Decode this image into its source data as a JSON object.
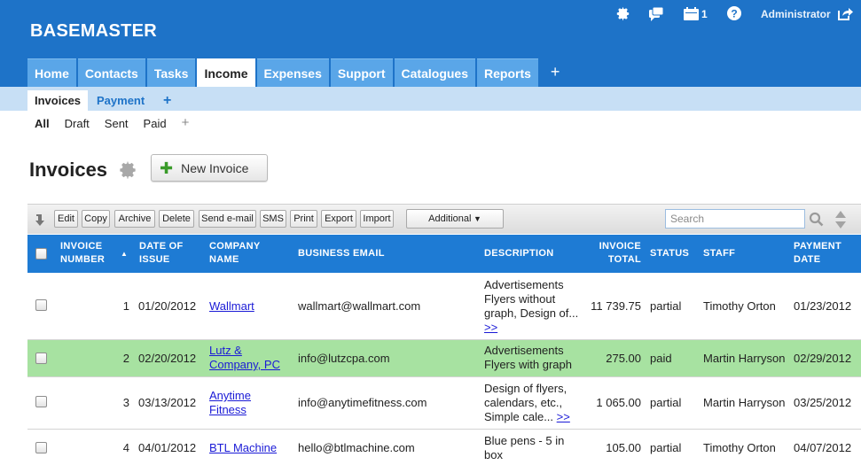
{
  "app": {
    "brand": "BASEMASTER"
  },
  "topbar": {
    "notification_count": "1",
    "user": "Administrator"
  },
  "main_tabs": [
    "Home",
    "Contacts",
    "Tasks",
    "Income",
    "Expenses",
    "Support",
    "Catalogues",
    "Reports"
  ],
  "main_tabs_plus": "+",
  "sub_tabs": [
    "Invoices",
    "Payment"
  ],
  "sub_tabs_plus": "+",
  "filters": [
    "All",
    "Draft",
    "Sent",
    "Paid"
  ],
  "filters_plus": "+",
  "page": {
    "title": "Invoices",
    "new_button": "New Invoice"
  },
  "toolbar": {
    "buttons": [
      "Edit",
      "Copy",
      "Archive",
      "Delete",
      "Send e-mail",
      "SMS",
      "Print",
      "Export",
      "Import"
    ],
    "additional": "Additional",
    "search_placeholder": "Search"
  },
  "table": {
    "headers": {
      "invoice_number": [
        "INVOICE",
        "NUMBER"
      ],
      "date_of_issue": [
        "DATE OF",
        "ISSUE"
      ],
      "company_name": [
        "COMPANY",
        "NAME"
      ],
      "business_email": "BUSINESS EMAIL",
      "description": "DESCRIPTION",
      "invoice_total": [
        "INVOICE",
        "TOTAL"
      ],
      "status": "STATUS",
      "staff": "STAFF",
      "payment_date": [
        "PAYMENT",
        "DATE"
      ]
    },
    "rows": [
      {
        "number": "1",
        "date": "01/20/2012",
        "company": [
          "Wallmart"
        ],
        "email": "wallmart@wallmart.com",
        "description": [
          "Advertisements",
          "Flyers without",
          "graph, Design of..."
        ],
        "more": ">>",
        "total": "11 739.75",
        "status": "partial",
        "staff": "Timothy Orton",
        "payment_date": "01/23/2012"
      },
      {
        "number": "2",
        "date": "02/20/2012",
        "company": [
          "Lutz &",
          "Company, PC"
        ],
        "email": "info@lutzcpa.com",
        "description": [
          "Advertisements",
          "Flyers with graph"
        ],
        "more": "",
        "total": "275.00",
        "status": "paid",
        "staff": "Martin Harryson",
        "payment_date": "02/29/2012"
      },
      {
        "number": "3",
        "date": "03/13/2012",
        "company": [
          "Anytime",
          "Fitness"
        ],
        "email": "info@anytimefitness.com",
        "description": [
          "Design of flyers,",
          "calendars, etc.,",
          "Simple cale..."
        ],
        "more": ">>",
        "total": "1 065.00",
        "status": "partial",
        "staff": "Martin Harryson",
        "payment_date": "03/25/2012"
      },
      {
        "number": "4",
        "date": "04/01/2012",
        "company": [
          "BTL Machine"
        ],
        "email": "hello@btlmachine.com",
        "description": [
          "Blue pens - 5 in",
          "box"
        ],
        "more": "",
        "total": "105.00",
        "status": "partial",
        "staff": "Timothy Orton",
        "payment_date": "04/07/2012"
      }
    ]
  },
  "colors": {
    "header_blue": "#1e73c8",
    "tab_blue": "#5aa6e8",
    "subbar": "#c7dff5",
    "table_header": "#1e7bd4",
    "highlight_row": "#a7e2a1",
    "link": "#1a1ad6"
  },
  "icons": [
    "gear-icon",
    "chat-icon",
    "calendar-icon",
    "help-icon",
    "logout-icon",
    "sort-arrow-icon",
    "search-icon",
    "scroll-arrows-icon",
    "plus-icon",
    "dropdown-arrow-icon"
  ]
}
